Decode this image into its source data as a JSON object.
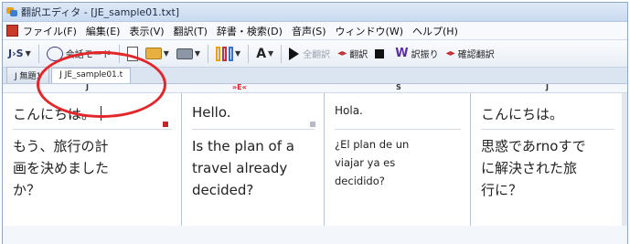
{
  "window": {
    "title": "翻訳エディタ - [JE_sample01.txt]"
  },
  "menubar": {
    "items": [
      "ファイル(F)",
      "編集(E)",
      "表示(V)",
      "翻訳(T)",
      "辞書・検索(D)",
      "音声(S)",
      "ウィンドウ(W)",
      "ヘルプ(H)"
    ]
  },
  "toolbar": {
    "js_label": "J›S",
    "conversation_mode_label": "会話モード",
    "translate_all_label": "全翻訳",
    "translate_label": "翻訳",
    "translation_check_label": "訳振り",
    "back_translate_label": "確認翻訳"
  },
  "tabs": [
    {
      "label": "J 無題1",
      "active": false
    },
    {
      "label": "J JE_sample01.t",
      "active": true
    }
  ],
  "columns": [
    {
      "label": "J",
      "highlighted": false
    },
    {
      "label": "»E«",
      "highlighted": true
    },
    {
      "label": "S",
      "highlighted": false
    },
    {
      "label": "J",
      "highlighted": false
    }
  ],
  "panes": [
    {
      "segment1": "こんにちは。",
      "segment2": "もう、旅行の計\n画を決めました\nか？"
    },
    {
      "segment1": "Hello.",
      "segment2": "Is the plan of a\ntravel already\ndecided?"
    },
    {
      "segment1": "Hola.",
      "segment2": "¿El plan de un\nviajar ya es\ndecidido?"
    },
    {
      "segment1": "こんにちは。",
      "segment2": "思惑であrnoすで\nに解決された旅\n行に？"
    }
  ],
  "colors": {
    "annotation": "#e3262a",
    "highlight_column": "#e0202a"
  }
}
